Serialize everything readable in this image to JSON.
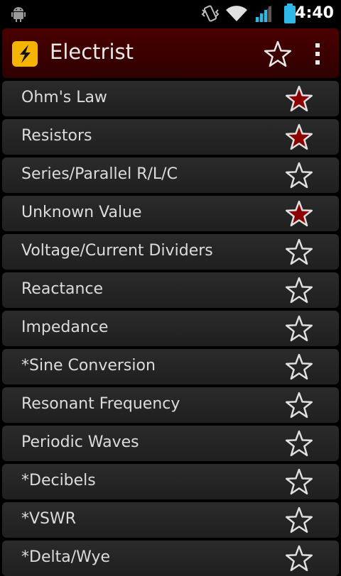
{
  "status_bar": {
    "time": "4:40",
    "icons": [
      "android-icon",
      "vibrate-icon",
      "wifi-icon",
      "signal-icon",
      "battery-icon"
    ]
  },
  "action_bar": {
    "title": "Electrist",
    "icons": [
      "lightning-logo-icon",
      "star-outline-icon",
      "overflow-menu-icon"
    ]
  },
  "colors": {
    "action_bar_bg": "#3c0000",
    "list_item_bg": "#262626",
    "favorite_star": "#8b0000",
    "text": "#dcdcdc",
    "battery": "#2fb9e8"
  },
  "items": [
    {
      "label": "Ohm's Law",
      "favorite": true
    },
    {
      "label": "Resistors",
      "favorite": true
    },
    {
      "label": "Series/Parallel R/L/C",
      "favorite": false
    },
    {
      "label": "Unknown Value",
      "favorite": true
    },
    {
      "label": "Voltage/Current Dividers",
      "favorite": false
    },
    {
      "label": "Reactance",
      "favorite": false
    },
    {
      "label": "Impedance",
      "favorite": false
    },
    {
      "label": "*Sine Conversion",
      "favorite": false
    },
    {
      "label": "Resonant Frequency",
      "favorite": false
    },
    {
      "label": "Periodic Waves",
      "favorite": false
    },
    {
      "label": "*Decibels",
      "favorite": false
    },
    {
      "label": "*VSWR",
      "favorite": false
    },
    {
      "label": "*Delta/Wye",
      "favorite": false
    }
  ]
}
